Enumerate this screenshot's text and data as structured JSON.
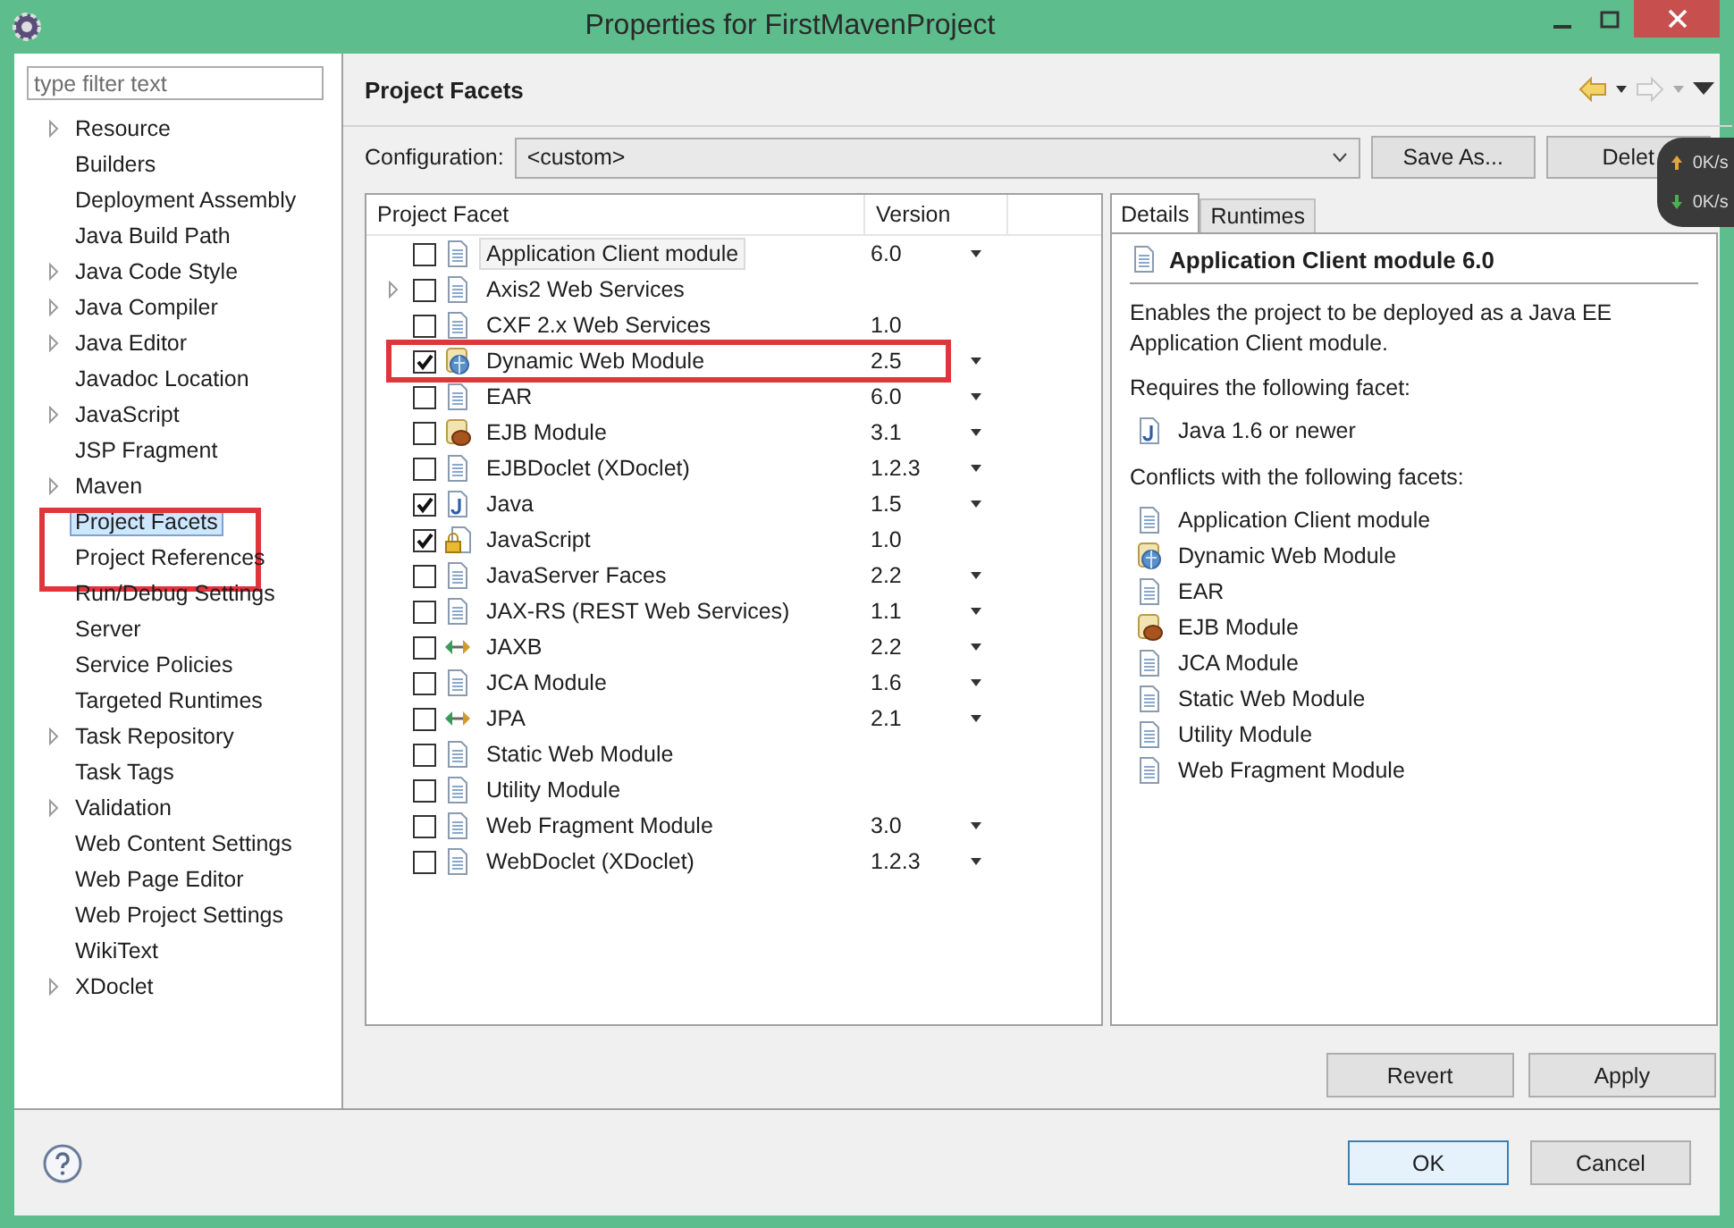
{
  "window": {
    "title": "Properties for FirstMavenProject"
  },
  "sidebar": {
    "filter_placeholder": "type filter text",
    "items": [
      {
        "label": "Resource",
        "expandable": true,
        "selected": false,
        "annotated": false
      },
      {
        "label": "Builders",
        "expandable": false,
        "selected": false,
        "annotated": false
      },
      {
        "label": "Deployment Assembly",
        "expandable": false,
        "selected": false,
        "annotated": false
      },
      {
        "label": "Java Build Path",
        "expandable": false,
        "selected": false,
        "annotated": false
      },
      {
        "label": "Java Code Style",
        "expandable": true,
        "selected": false,
        "annotated": false
      },
      {
        "label": "Java Compiler",
        "expandable": true,
        "selected": false,
        "annotated": false
      },
      {
        "label": "Java Editor",
        "expandable": true,
        "selected": false,
        "annotated": false
      },
      {
        "label": "Javadoc Location",
        "expandable": false,
        "selected": false,
        "annotated": false
      },
      {
        "label": "JavaScript",
        "expandable": true,
        "selected": false,
        "annotated": false
      },
      {
        "label": "JSP Fragment",
        "expandable": false,
        "selected": false,
        "annotated": false
      },
      {
        "label": "Maven",
        "expandable": true,
        "selected": false,
        "annotated": false
      },
      {
        "label": "Project Facets",
        "expandable": false,
        "selected": true,
        "annotated": true
      },
      {
        "label": "Project References",
        "expandable": false,
        "selected": false,
        "annotated": false
      },
      {
        "label": "Run/Debug Settings",
        "expandable": false,
        "selected": false,
        "annotated": false
      },
      {
        "label": "Server",
        "expandable": false,
        "selected": false,
        "annotated": false
      },
      {
        "label": "Service Policies",
        "expandable": false,
        "selected": false,
        "annotated": false
      },
      {
        "label": "Targeted Runtimes",
        "expandable": false,
        "selected": false,
        "annotated": false
      },
      {
        "label": "Task Repository",
        "expandable": true,
        "selected": false,
        "annotated": false
      },
      {
        "label": "Task Tags",
        "expandable": false,
        "selected": false,
        "annotated": false
      },
      {
        "label": "Validation",
        "expandable": true,
        "selected": false,
        "annotated": false
      },
      {
        "label": "Web Content Settings",
        "expandable": false,
        "selected": false,
        "annotated": false
      },
      {
        "label": "Web Page Editor",
        "expandable": false,
        "selected": false,
        "annotated": false
      },
      {
        "label": "Web Project Settings",
        "expandable": false,
        "selected": false,
        "annotated": false
      },
      {
        "label": "WikiText",
        "expandable": false,
        "selected": false,
        "annotated": false
      },
      {
        "label": "XDoclet",
        "expandable": true,
        "selected": false,
        "annotated": false
      }
    ]
  },
  "page": {
    "title": "Project Facets",
    "configuration_label": "Configuration:",
    "configuration_value": "<custom>",
    "buttons": [
      "Save As...",
      "Delet"
    ]
  },
  "network_widget": {
    "upload": "0K/s",
    "download": "0K/s"
  },
  "facets": {
    "columns": [
      "Project Facet",
      "Version"
    ],
    "rows": [
      {
        "name": "Application Client module",
        "version": "6.0",
        "checked": false,
        "selected": true,
        "dropdown": true,
        "expandable": false,
        "kind": "page",
        "annotated": false
      },
      {
        "name": "Axis2 Web Services",
        "checked": false,
        "selected": false,
        "dropdown": false,
        "expandable": true,
        "kind": "page",
        "annotated": false
      },
      {
        "name": "CXF 2.x Web Services",
        "version": "1.0",
        "checked": false,
        "selected": false,
        "dropdown": false,
        "expandable": false,
        "kind": "page",
        "annotated": false
      },
      {
        "name": "Dynamic Web Module",
        "version": "2.5",
        "checked": true,
        "selected": false,
        "dropdown": true,
        "expandable": false,
        "kind": "web",
        "annotated": true
      },
      {
        "name": "EAR",
        "version": "6.0",
        "checked": false,
        "selected": false,
        "dropdown": true,
        "expandable": false,
        "kind": "page",
        "annotated": false
      },
      {
        "name": "EJB Module",
        "version": "3.1",
        "checked": false,
        "selected": false,
        "dropdown": true,
        "expandable": false,
        "kind": "ejb",
        "annotated": false
      },
      {
        "name": "EJBDoclet (XDoclet)",
        "version": "1.2.3",
        "checked": false,
        "selected": false,
        "dropdown": true,
        "expandable": false,
        "kind": "page",
        "annotated": false
      },
      {
        "name": "Java",
        "version": "1.5",
        "checked": true,
        "selected": false,
        "dropdown": true,
        "expandable": false,
        "kind": "java",
        "annotated": false
      },
      {
        "name": "JavaScript",
        "version": "1.0",
        "checked": true,
        "selected": false,
        "dropdown": false,
        "expandable": false,
        "kind": "locked",
        "annotated": false
      },
      {
        "name": "JavaServer Faces",
        "version": "2.2",
        "checked": false,
        "selected": false,
        "dropdown": true,
        "expandable": false,
        "kind": "page",
        "annotated": false
      },
      {
        "name": "JAX-RS (REST Web Services)",
        "version": "1.1",
        "checked": false,
        "selected": false,
        "dropdown": true,
        "expandable": false,
        "kind": "page",
        "annotated": false
      },
      {
        "name": "JAXB",
        "version": "2.2",
        "checked": false,
        "selected": false,
        "dropdown": true,
        "expandable": false,
        "kind": "arrows",
        "annotated": false
      },
      {
        "name": "JCA Module",
        "version": "1.6",
        "checked": false,
        "selected": false,
        "dropdown": true,
        "expandable": false,
        "kind": "page",
        "annotated": false
      },
      {
        "name": "JPA",
        "version": "2.1",
        "checked": false,
        "selected": false,
        "dropdown": true,
        "expandable": false,
        "kind": "arrows",
        "annotated": false
      },
      {
        "name": "Static Web Module",
        "checked": false,
        "selected": false,
        "dropdown": false,
        "expandable": false,
        "kind": "page",
        "annotated": false
      },
      {
        "name": "Utility Module",
        "checked": false,
        "selected": false,
        "dropdown": false,
        "expandable": false,
        "kind": "page",
        "annotated": false
      },
      {
        "name": "Web Fragment Module",
        "version": "3.0",
        "checked": false,
        "selected": false,
        "dropdown": true,
        "expandable": false,
        "kind": "page",
        "annotated": false
      },
      {
        "name": "WebDoclet (XDoclet)",
        "version": "1.2.3",
        "checked": false,
        "selected": false,
        "dropdown": true,
        "expandable": false,
        "kind": "page",
        "annotated": false
      }
    ]
  },
  "details": {
    "tabs": [
      {
        "label": "Details",
        "selected": true
      },
      {
        "label": "Runtimes",
        "selected": false
      }
    ],
    "title": "Application Client module 6.0",
    "description": "Enables the project to be deployed as a Java EE Application Client module.",
    "requires_label": "Requires the following facet:",
    "requires": [
      {
        "name": "Java 1.6 or newer",
        "kind": "java"
      }
    ],
    "conflicts_label": "Conflicts with the following facets:",
    "conflicts": [
      {
        "name": "Application Client module",
        "kind": "page"
      },
      {
        "name": "Dynamic Web Module",
        "kind": "web"
      },
      {
        "name": "EAR",
        "kind": "page"
      },
      {
        "name": "EJB Module",
        "kind": "ejb"
      },
      {
        "name": "JCA Module",
        "kind": "page"
      },
      {
        "name": "Static Web Module",
        "kind": "page"
      },
      {
        "name": "Utility Module",
        "kind": "page"
      },
      {
        "name": "Web Fragment Module",
        "kind": "page"
      }
    ]
  },
  "page_buttons": [
    "Revert",
    "Apply"
  ],
  "dialog_buttons": [
    {
      "label": "OK",
      "default": true
    },
    {
      "label": "Cancel",
      "default": false
    }
  ]
}
